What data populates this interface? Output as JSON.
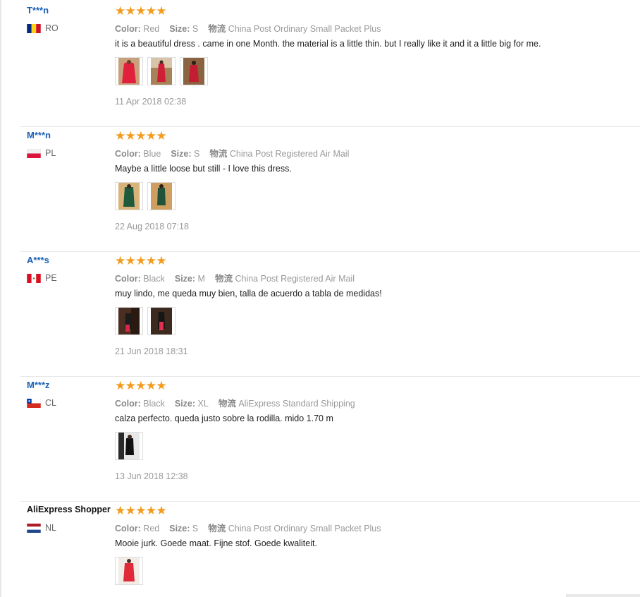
{
  "labels": {
    "color": "Color:",
    "size": "Size:",
    "shipping": "物流"
  },
  "reviews": [
    {
      "user": "T***n",
      "country": "RO",
      "flag": "ro",
      "rating": 5,
      "color": "Red",
      "size": "S",
      "shipping": "China Post Ordinary Small Packet Plus",
      "text": "it is a beautiful dress . came in one Month. the material is a little thin. but I really like it and it a little big for me.",
      "photos": 3,
      "date": "11 Apr 2018 02:38"
    },
    {
      "user": "M***n",
      "country": "PL",
      "flag": "pl",
      "rating": 5,
      "color": "Blue",
      "size": "S",
      "shipping": "China Post Registered Air Mail",
      "text": "Maybe a little loose but still - I love this dress.",
      "photos": 2,
      "date": "22 Aug 2018 07:18"
    },
    {
      "user": "A***s",
      "country": "PE",
      "flag": "pe",
      "rating": 5,
      "color": "Black",
      "size": "M",
      "shipping": "China Post Registered Air Mail",
      "text": "muy lindo, me queda muy bien, talla de acuerdo a tabla de medidas!",
      "photos": 2,
      "date": "21 Jun 2018 18:31"
    },
    {
      "user": "M***z",
      "country": "CL",
      "flag": "cl",
      "rating": 5,
      "color": "Black",
      "size": "XL",
      "shipping": "AliExpress Standard Shipping",
      "text": "calza perfecto. queda justo sobre la rodilla. mido 1.70 m",
      "photos": 1,
      "date": "13 Jun 2018 12:38"
    },
    {
      "user": "AliExpress Shopper",
      "country": "NL",
      "flag": "nl",
      "rating": 5,
      "color": "Red",
      "size": "S",
      "shipping": "China Post Ordinary Small Packet Plus",
      "text": "Mooie jurk. Goede maat. Fijne stof. Goede kwaliteit.",
      "photos": 1,
      "date": ""
    }
  ]
}
